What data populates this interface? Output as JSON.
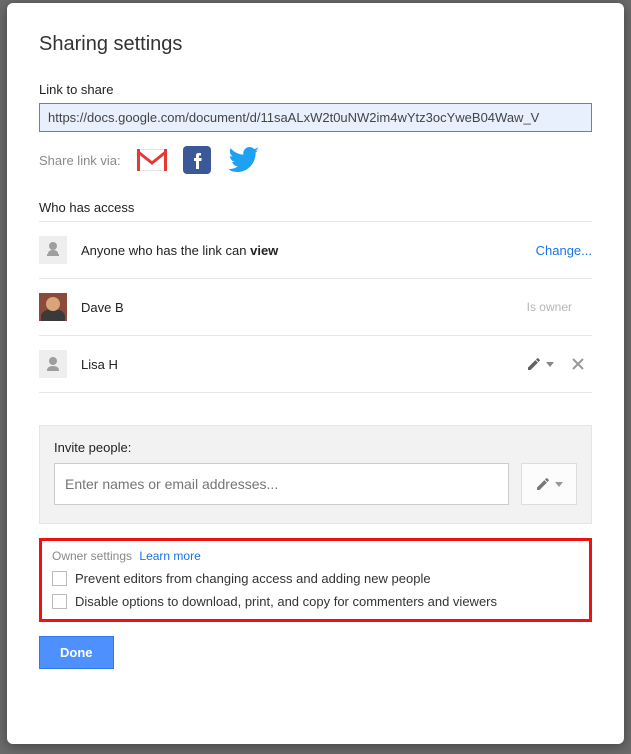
{
  "dialog": {
    "title": "Sharing settings",
    "link_label": "Link to share",
    "share_url": "https://docs.google.com/document/d/11saALxW2t0uNW2im4wYtz3ocYweB04Waw_V",
    "share_via_label": "Share link via:",
    "access_header": "Who has access",
    "link_access_prefix": "Anyone who has the link can ",
    "link_access_perm": "view",
    "change_label": "Change...",
    "people": [
      {
        "name": "Dave B",
        "role": "Is owner"
      },
      {
        "name": "Lisa H",
        "role": "editor"
      }
    ],
    "invite_label": "Invite people:",
    "invite_placeholder": "Enter names or email addresses...",
    "owner_settings_label": "Owner settings",
    "learn_more": "Learn more",
    "checkbox1": "Prevent editors from changing access and adding new people",
    "checkbox2": "Disable options to download, print, and copy for commenters and viewers",
    "done": "Done"
  },
  "icons": {
    "gmail": "gmail-icon",
    "facebook": "facebook-icon",
    "twitter": "twitter-icon",
    "globe": "globe-icon",
    "person": "person-icon",
    "pencil": "pencil-icon",
    "caret": "caret-down-icon",
    "close": "close-icon"
  }
}
